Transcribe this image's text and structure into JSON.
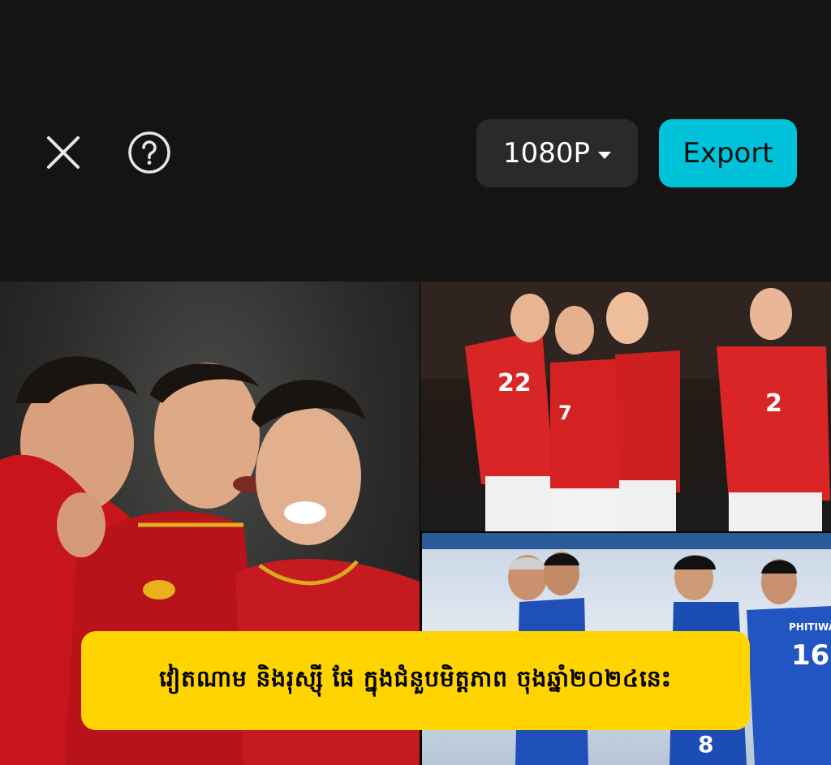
{
  "toolbar": {
    "close_icon": "close-icon",
    "help_icon": "help-icon",
    "resolution_label": "1080P",
    "export_label": "Export"
  },
  "colors": {
    "background": "#141414",
    "resolution_button": "#2a2a2c",
    "export_button": "#00c2d9",
    "caption_background": "#ffd400"
  },
  "preview": {
    "caption": "វៀតណាម និងរុស្ស៊ី ផែ ក្នុងជំនួបមិត្តភាព ចុងឆ្នាំ២០២៤នេះ",
    "jersey_numbers": [
      "22",
      "7",
      "2",
      "16",
      "8"
    ],
    "jersey_name": "PHITIWAT"
  }
}
